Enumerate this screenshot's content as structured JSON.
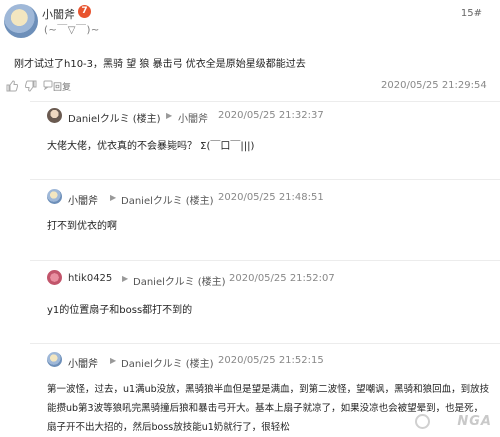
{
  "post": {
    "username": "小闇斧",
    "level": "7",
    "floor": "15#",
    "signature": "(~￣▽￣)~",
    "content": "刚才试过了h10-3，黑骑 望 狼 暴击弓 优衣全是原始星级都能过去",
    "reply_label": "回复",
    "time": "2020/05/25 21:29:54"
  },
  "comments": [
    {
      "author": "Danielクルミ (楼主)",
      "target": "小闇斧",
      "time": "2020/05/25 21:32:37",
      "text": "大佬大佬，优衣真的不会暴毙吗？ Σ(￣口￣|||)"
    },
    {
      "author": "小闇斧",
      "target": "Danielクルミ (楼主)",
      "time": "2020/05/25 21:48:51",
      "text": "打不到优衣的啊"
    },
    {
      "author": "htik0425",
      "target": "Danielクルミ (楼主)",
      "time": "2020/05/25 21:52:07",
      "text": "y1的位置扇子和boss都打不到的"
    },
    {
      "author": "小闇斧",
      "target": "Danielクルミ (楼主)",
      "time": "2020/05/25 21:52:15",
      "text_lines": [
        "第一波怪，过去，u1满ub没放，黑骑狼半血但是望是满血，到第二波怪，望嘲讽，黑骑和狼回血，到放技",
        "能攒ub第3波等狼吼完黑骑撞后狼和暴击弓开大。基本上扇子就凉了，如果没凉也会被望晕到，也是死，",
        "扇子开不出大招的，然后boss放技能u1奶就行了，很轻松"
      ]
    }
  ],
  "watermark": "NGA"
}
